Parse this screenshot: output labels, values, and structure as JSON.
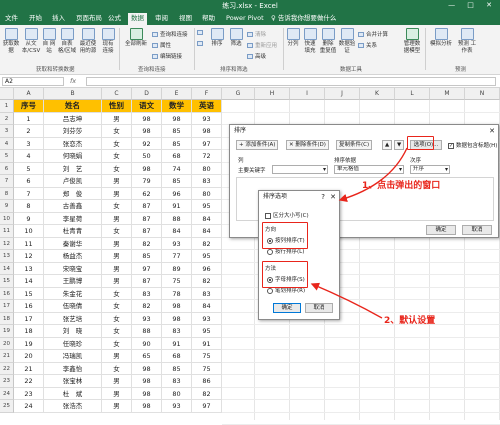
{
  "window": {
    "title": "练习.xlsx - Excel",
    "controls": "— □ ✕"
  },
  "tabs": [
    "文件",
    "开始",
    "插入",
    "页面布局",
    "公式",
    "数据",
    "审阅",
    "视图",
    "帮助",
    "Power Pivot",
    "♀ 告诉我你想要做什么"
  ],
  "active_tab": "数据",
  "ribbon": {
    "get_data": [
      "获取数\n据",
      "从文\n本/CSV",
      "自\n网站",
      "自表\n格/区域",
      "最近使\n用的源",
      "现有\n连接"
    ],
    "refresh": "全部刷新",
    "queries": [
      "查询和连接",
      "属性",
      "编辑链接"
    ],
    "sort": [
      "排序",
      "筛选"
    ],
    "filter_small": [
      "清除",
      "重新应用",
      "高级"
    ],
    "tools": [
      "分列",
      "快速\n填充",
      "删除\n重复值",
      "数据验\n证",
      "合并计算",
      "关系",
      "管理数\n据模型"
    ],
    "forecast": [
      "模拟分析",
      "预测\n工作表"
    ],
    "groups": [
      "获取和转换数据",
      "查询和连接",
      "排序和筛选",
      "数据工具",
      "预测"
    ]
  },
  "namebox": "A2",
  "columns": [
    "A",
    "B",
    "C",
    "D",
    "E",
    "F",
    "G",
    "H",
    "I",
    "J",
    "K",
    "L",
    "M",
    "N",
    "O"
  ],
  "table": {
    "headers": [
      "序号",
      "姓名",
      "性别",
      "语文",
      "数学",
      "英语"
    ],
    "rows": [
      [
        "1",
        "吕志坤",
        "男",
        "98",
        "98",
        "93"
      ],
      [
        "2",
        "刘芬莎",
        "女",
        "98",
        "85",
        "98"
      ],
      [
        "3",
        "张恋杰",
        "女",
        "92",
        "85",
        "97"
      ],
      [
        "4",
        "何晓娟",
        "女",
        "50",
        "68",
        "72"
      ],
      [
        "5",
        "刘　艺",
        "女",
        "98",
        "74",
        "80"
      ],
      [
        "6",
        "卢俊凯",
        "男",
        "79",
        "85",
        "83"
      ],
      [
        "7",
        "郑　俊",
        "男",
        "62",
        "96",
        "80"
      ],
      [
        "8",
        "古善鑫",
        "女",
        "87",
        "91",
        "95"
      ],
      [
        "9",
        "李星荷",
        "男",
        "87",
        "88",
        "84"
      ],
      [
        "10",
        "杜青青",
        "女",
        "87",
        "84",
        "84"
      ],
      [
        "11",
        "秦谢华",
        "男",
        "82",
        "93",
        "82"
      ],
      [
        "12",
        "杨益杰",
        "男",
        "85",
        "77",
        "95"
      ],
      [
        "13",
        "宋晓宝",
        "男",
        "97",
        "89",
        "96"
      ],
      [
        "14",
        "王鹏博",
        "男",
        "87",
        "75",
        "82"
      ],
      [
        "15",
        "朱金花",
        "女",
        "83",
        "78",
        "83"
      ],
      [
        "16",
        "伍晓倩",
        "女",
        "82",
        "98",
        "84"
      ],
      [
        "17",
        "张艺培",
        "女",
        "93",
        "98",
        "93"
      ],
      [
        "18",
        "刘　晓",
        "女",
        "88",
        "83",
        "95"
      ],
      [
        "19",
        "任晓珍",
        "女",
        "90",
        "91",
        "91"
      ],
      [
        "20",
        "冯瑞凯",
        "男",
        "65",
        "68",
        "75"
      ],
      [
        "21",
        "李鑫怡",
        "女",
        "98",
        "85",
        "75"
      ],
      [
        "22",
        "张宝林",
        "男",
        "98",
        "83",
        "86"
      ],
      [
        "23",
        "杜　斌",
        "男",
        "98",
        "80",
        "82"
      ],
      [
        "24",
        "张浩杰",
        "男",
        "98",
        "93",
        "97"
      ]
    ]
  },
  "sort_dialog": {
    "title": "排序",
    "toolbar": [
      "+ 添加条件(A)",
      "✕ 删除条件(D)",
      "复制条件(C)",
      "▲",
      "▼"
    ],
    "options_btn": "选项(O)...",
    "has_header": "数据包含标题(H)",
    "col_headers": [
      "列",
      "排序依据",
      "次序"
    ],
    "row": {
      "key": "主要关键字",
      "col": "",
      "basis": "单元格值",
      "order": "升序"
    },
    "ok": "确定",
    "cancel": "取消"
  },
  "options_dialog": {
    "title": "排序选项",
    "case": "区分大小写(C)",
    "direction_label": "方向",
    "direction": [
      "按列排序(T)",
      "按行排序(L)"
    ],
    "method_label": "方法",
    "method": [
      "字母排序(S)",
      "笔划排序(R)"
    ],
    "ok": "确定",
    "cancel": "取消"
  },
  "annotations": [
    "1、点击弹出的窗口",
    "2、默认设置"
  ]
}
